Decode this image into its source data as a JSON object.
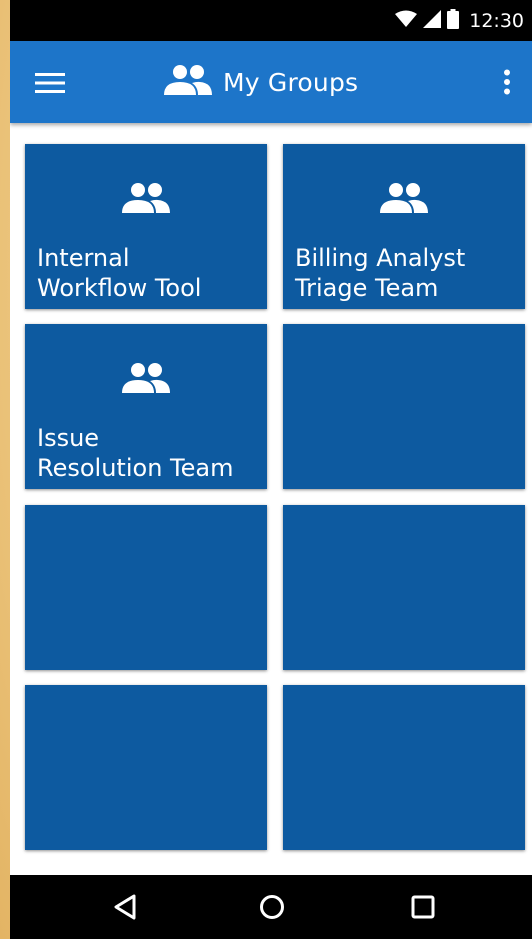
{
  "status_bar": {
    "time": "12:30",
    "icons": [
      "wifi-icon",
      "signal-icon",
      "battery-icon"
    ]
  },
  "app_bar": {
    "title": "My Groups",
    "title_icon": "group-icon",
    "menu_icon": "hamburger-menu-icon",
    "overflow_icon": "more-vert-icon"
  },
  "groups": [
    {
      "label": "Internal\nWorkflow Tool",
      "icon": "group-icon"
    },
    {
      "label": "Billing Analyst\nTriage Team",
      "icon": "group-icon"
    },
    {
      "label": "Issue\nResolution Team",
      "icon": "group-icon"
    },
    {
      "label": "",
      "icon": ""
    },
    {
      "label": "",
      "icon": ""
    },
    {
      "label": "",
      "icon": ""
    },
    {
      "label": "",
      "icon": ""
    },
    {
      "label": "",
      "icon": ""
    }
  ],
  "nav_bar": {
    "back_icon": "back-triangle-icon",
    "home_icon": "home-circle-icon",
    "recents_icon": "recents-square-icon"
  },
  "colors": {
    "app_bar": "#1d75c9",
    "tile": "#0d5aa0",
    "status_bar": "#000000",
    "nav_bar": "#000000",
    "text": "#ffffff"
  }
}
